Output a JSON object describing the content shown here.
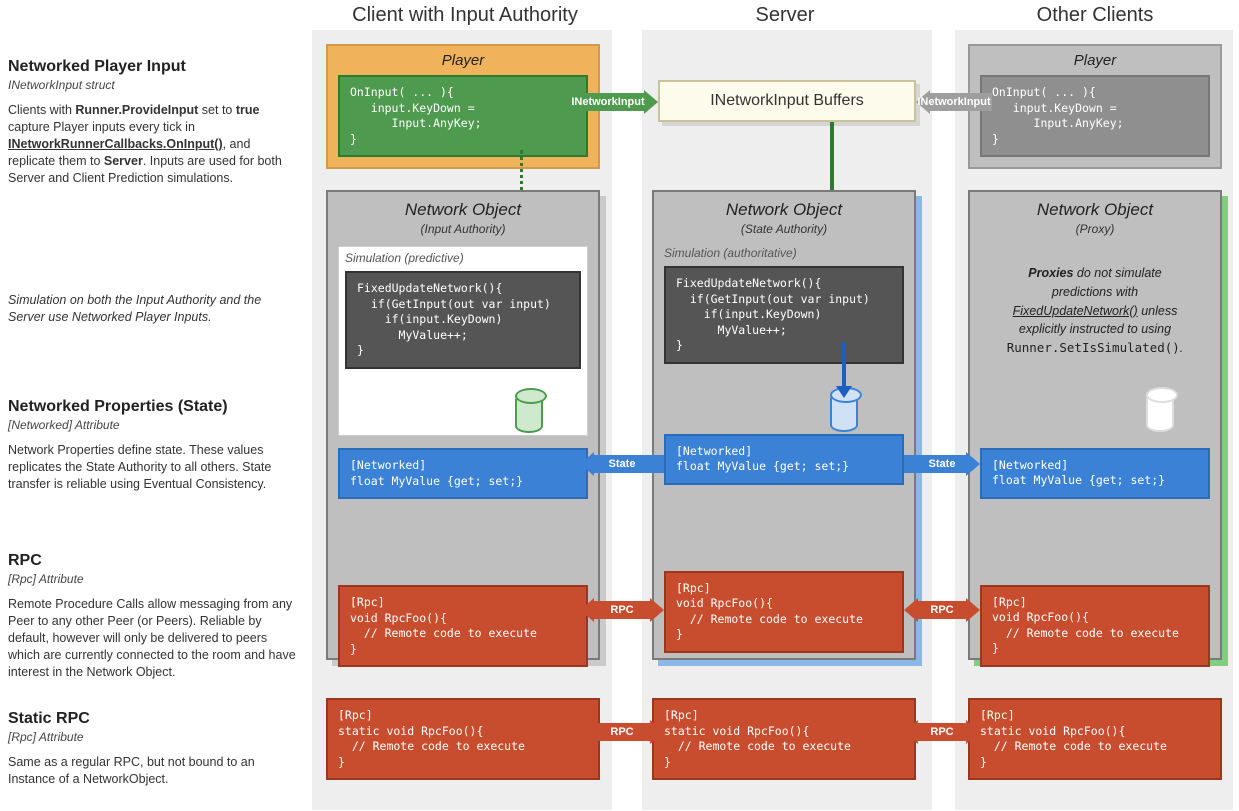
{
  "columns": {
    "client": "Client with Input Authority",
    "server": "Server",
    "others": "Other Clients"
  },
  "left": {
    "input": {
      "title": "Networked Player Input",
      "sub": "INetworkInput struct",
      "body": "Clients with <b>Runner.ProvideInput</b> set to <b>true</b> capture Player inputs every tick in <u>INetworkRunnerCallbacks.OnInput()</u>, and replicate them to <b>Server</b>. Inputs are used for both Server and Client Prediction simulations."
    },
    "sim": {
      "body": "Simulation on both the Input Authority and the Server use Networked Player Inputs."
    },
    "state": {
      "title": "Networked Properties (State)",
      "sub": "[Networked] Attribute",
      "body": "Network Properties define state. These values replicates the State Authority to all others. State transfer is reliable using Eventual Consistency."
    },
    "rpc": {
      "title": "RPC",
      "sub": "[Rpc] Attribute",
      "body": "Remote Procedure Calls allow messaging from any Peer to any other Peer (or Peers). Reliable by default, however will only be delivered to peers which are currently connected to the room and have interest in  the Network Object."
    },
    "srpc": {
      "title": "Static RPC",
      "sub": "[Rpc] Attribute",
      "body": "Same as a regular RPC, but not bound to an Instance of a NetworkObject."
    }
  },
  "player": {
    "title": "Player",
    "code": "OnInput( ... ){\n   input.KeyDown =\n      Input.AnyKey;\n}"
  },
  "buffer": "INetworkInput Buffers",
  "labels": {
    "inet": "INetworkInput",
    "state": "State",
    "rpc": "RPC"
  },
  "nobox": {
    "client": {
      "title": "Network Object",
      "sub": "(Input Authority)",
      "sim": "Simulation (predictive)"
    },
    "server": {
      "title": "Network Object",
      "sub": "(State Authority)",
      "sim": "Simulation (authoritative)"
    },
    "proxy": {
      "title": "Network Object",
      "sub": "(Proxy)"
    }
  },
  "code": {
    "fun": "FixedUpdateNetwork(){\n  if(GetInput(out var input)\n    if(input.KeyDown)\n      MyValue++;\n}",
    "networked": "[Networked]\nfloat MyValue {get; set;}",
    "rpc": "[Rpc]\nvoid RpcFoo(){\n  // Remote code to execute\n}",
    "srpc": "[Rpc]\nstatic void RpcFoo(){\n  // Remote code to execute\n}"
  },
  "proxy_note": "<b>Proxies</b> do not simulate predictions with <u>FixedUpdateNetwork()</u> unless explicitly instructed to using <span class='mono'>Runner.SetIsSimulated()</span>."
}
